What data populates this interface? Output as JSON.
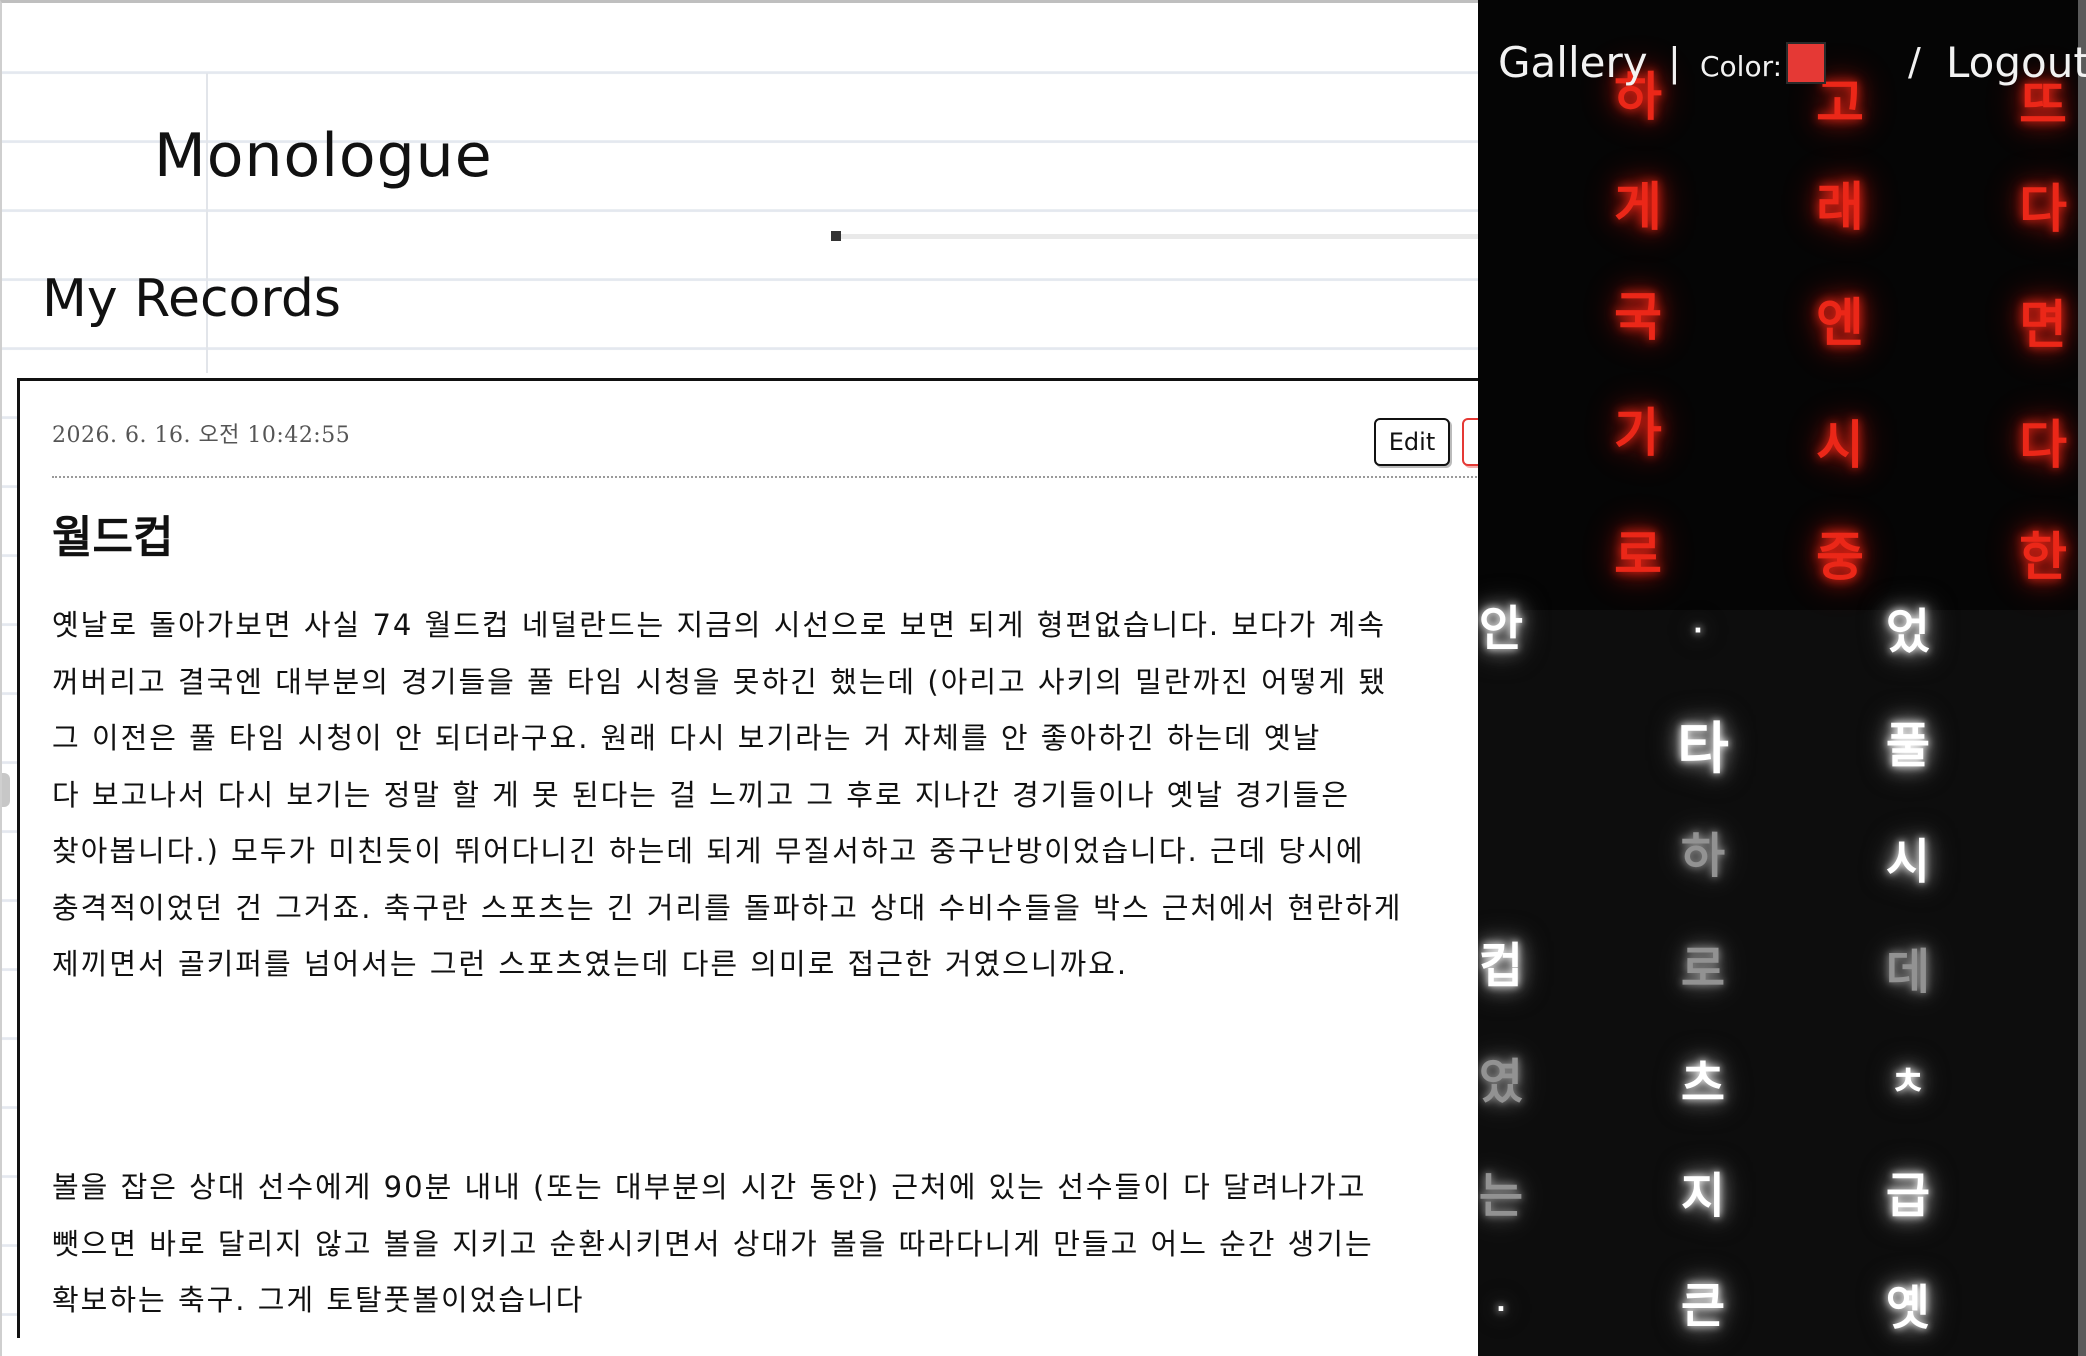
{
  "app": {
    "title": "Monologue",
    "section_title": "My Records"
  },
  "nav": {
    "gallery_label": "Gallery",
    "separator_1": "|",
    "color_label": "Color:",
    "color_value": "#e53935",
    "separator_2": "/",
    "logout_label": "Logout"
  },
  "record": {
    "date": "2026. 6. 16. 오전 10:42:55",
    "edit_label": "Edit",
    "title": "월드컵",
    "body_paragraph_1": "옛날로 돌아가보면 사실 74 월드컵 네덜란드는 지금의 시선으로 보면 되게 형편없습니다. 보다가 계속\n꺼버리고 결국엔 대부분의 경기들을 풀 타임 시청을 못하긴 했는데 (아리고 사키의 밀란까진 어떻게 됐\n그 이전은 풀 타임 시청이 안 되더라구요. 원래 다시 보기라는 거 자체를 안 좋아하긴 하는데 옛날 \n다 보고나서 다시 보기는 정말 할 게 못 된다는 걸 느끼고 그 후로 지나간 경기들이나 옛날 경기들은 \n찾아봅니다.) 모두가 미친듯이 뛰어다니긴 하는데 되게 무질서하고 중구난방이었습니다. 근데 당시에\n충격적이었던 건 그거죠. 축구란 스포츠는 긴 거리를 돌파하고 상대 수비수들을 박스 근처에서 현란하게\n제끼면서 골키퍼를 넘어서는 그런 스포츠였는데 다른 의미로 접근한 거였으니까요.",
    "body_paragraph_2": "볼을 잡은 상대 선수에게 90분 내내 (또는 대부분의 시간 동안) 근처에 있는 선수들이 다 달려나가고\n뺏으면 바로 달리지 않고 볼을 지키고 순환시키면서 상대가 볼을 따라다니게 만들고 어느 순간 생기는\n확보하는 축구. 그게 토탈풋볼이었습니다"
  },
  "gallery": {
    "red_columns": [
      [
        "하",
        "게",
        "국",
        "가",
        "로"
      ],
      [
        "고",
        "래",
        "엔",
        "시",
        "중"
      ],
      [
        "뜨",
        "다",
        "면",
        "다",
        "한"
      ]
    ],
    "white_glyphs": [
      "안",
      "·",
      "었",
      "타",
      "풀",
      "하",
      "시",
      "컵",
      "로",
      "데",
      "였",
      "츠",
      "ㅊ",
      "는",
      "지",
      "급",
      ".",
      "큰",
      "옛"
    ]
  }
}
